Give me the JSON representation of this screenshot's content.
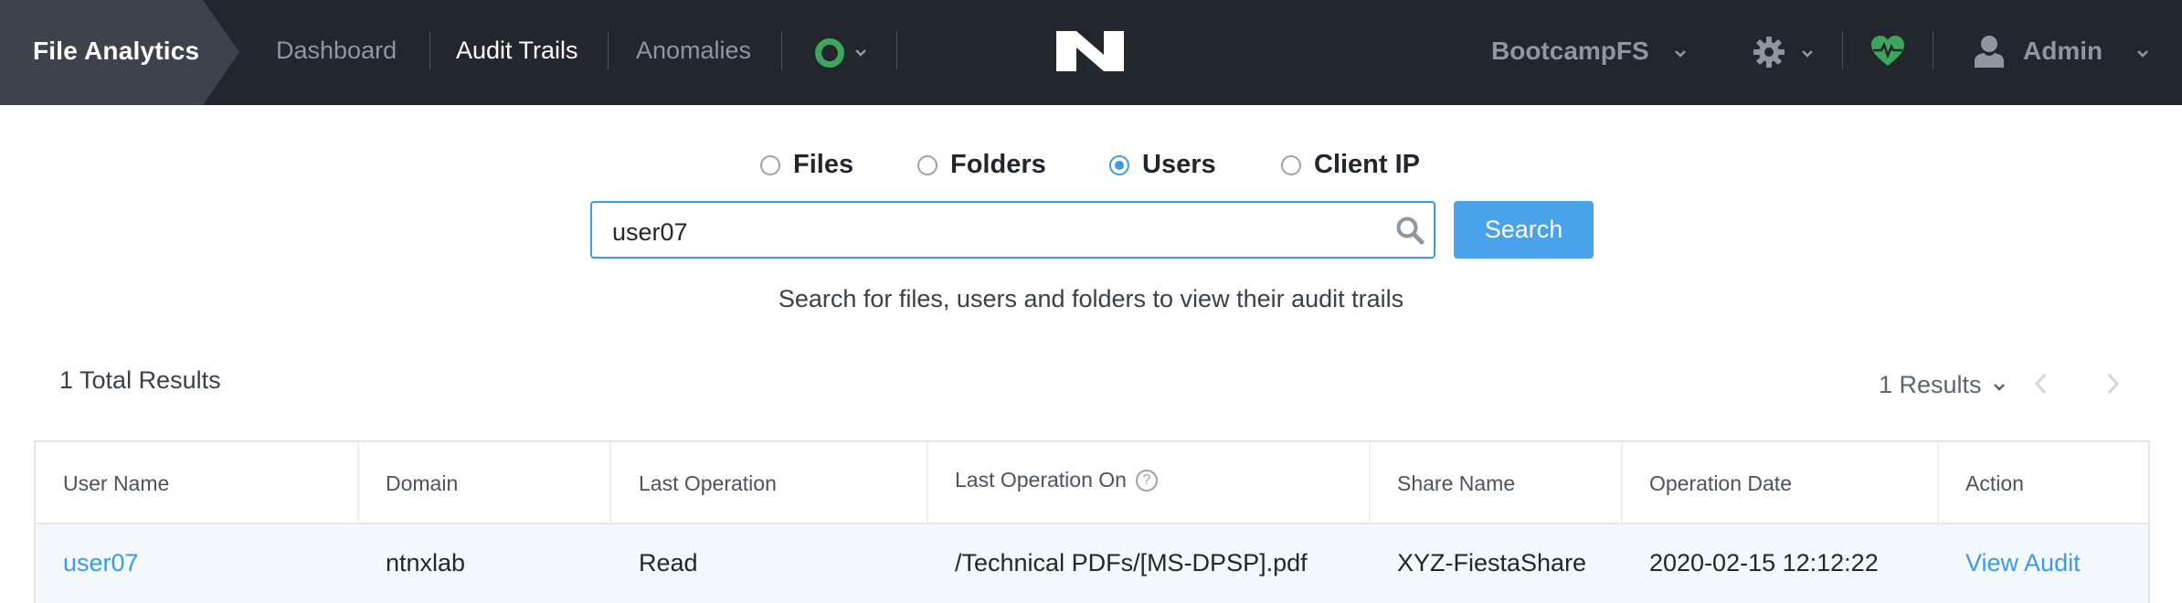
{
  "app": {
    "title": "File Analytics",
    "nav": [
      {
        "label": "Dashboard",
        "active": false
      },
      {
        "label": "Audit Trails",
        "active": true
      },
      {
        "label": "Anomalies",
        "active": false
      }
    ],
    "status_color": "#3ea55d",
    "file_server": "BootcampFS",
    "user": "Admin",
    "icons": [
      "status-dot-icon",
      "nutanix-logo",
      "gear-icon",
      "health-heart-icon",
      "user-icon"
    ]
  },
  "search": {
    "options": [
      {
        "label": "Files",
        "selected": false
      },
      {
        "label": "Folders",
        "selected": false
      },
      {
        "label": "Users",
        "selected": true
      },
      {
        "label": "Client IP",
        "selected": false
      }
    ],
    "value": "user07",
    "button_label": "Search",
    "helper_text": "Search for files, users and folders to view their audit trails"
  },
  "results": {
    "total_label": "1 Total Results",
    "count_label": "1 Results",
    "table": {
      "headers": [
        "User Name",
        "Domain",
        "Last Operation",
        "Last Operation On",
        "Share Name",
        "Operation Date",
        "Action"
      ],
      "help_mark": "?",
      "rows": [
        [
          "user07",
          "ntnxlab",
          "Read",
          "/Technical PDFs/[MS-DPSP].pdf",
          "XYZ-FiestaShare",
          "2020-02-15 12:12:22",
          "View Audit"
        ]
      ]
    }
  },
  "colors": {
    "topbar": "#22272e",
    "brand": "#3c434c",
    "accent": "#3b9be8",
    "button": "#4aa3ea",
    "row_highlight": "#f2f8fc"
  }
}
